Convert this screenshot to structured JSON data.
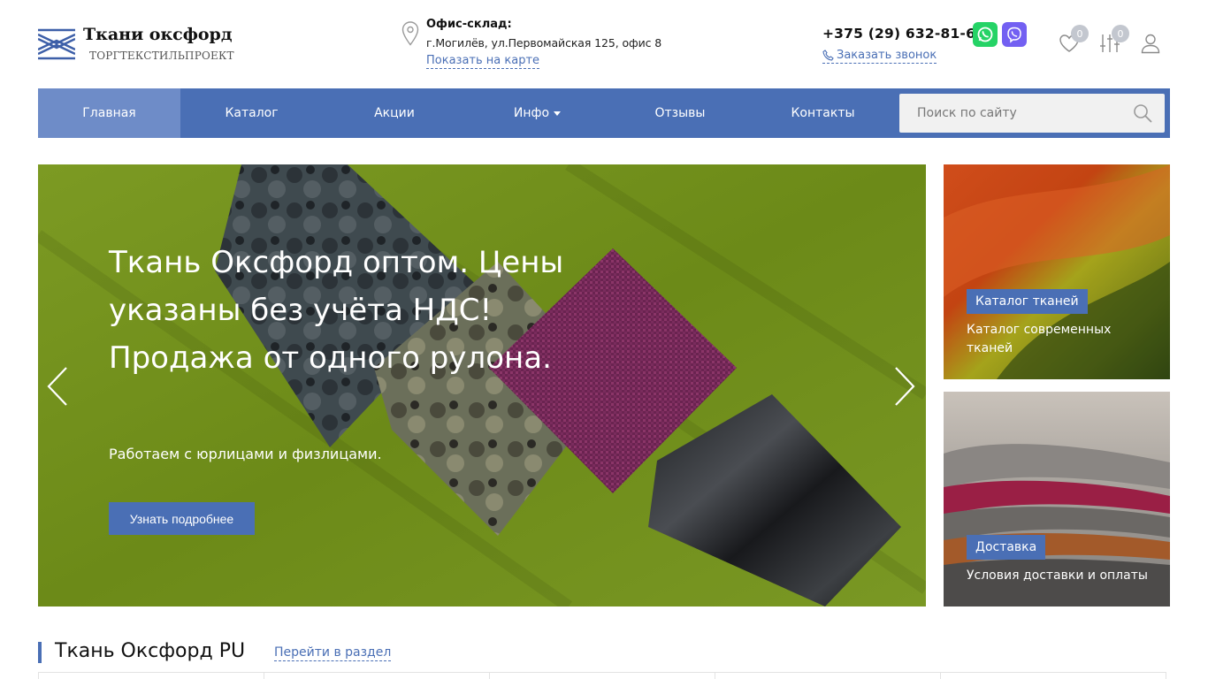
{
  "header": {
    "logo_title": "Ткани оксфорд",
    "logo_subtitle": "ТОРГТЕКСТИЛЬПРОЕКТ",
    "office_label": "Офис-склад:",
    "office_address": "г.Могилёв, ул.Первомайская 125, офис 8",
    "map_link": "Показать на карте",
    "phone": "+375 (29) 632-81-61",
    "call_link": "Заказать звонок",
    "favorites_count": "0",
    "compare_count": "0",
    "icons": {
      "pin": "map-pin-icon",
      "whatsapp": "whatsapp-icon",
      "viber": "viber-icon",
      "favorites": "heart-icon",
      "compare": "sliders-icon",
      "user": "user-icon",
      "call": "phone-icon"
    }
  },
  "nav": {
    "items": [
      {
        "label": "Главная",
        "active": true
      },
      {
        "label": "Каталог"
      },
      {
        "label": "Акции"
      },
      {
        "label": "Инфо"
      },
      {
        "label": "Отзывы"
      },
      {
        "label": "Контакты"
      }
    ],
    "search_placeholder": "Поиск по сайту"
  },
  "hero": {
    "title": "Ткань Оксфорд оптом. Цены указаны без учёта НДС! Продажа от одного рулона.",
    "subtitle": "Работаем с юрлицами и физлицами.",
    "button": "Узнать подробнее"
  },
  "cards": [
    {
      "tag": "Каталог тканей",
      "text": "Каталог современных тканей"
    },
    {
      "tag": "Доставка",
      "text": "Условия доставки и оплаты"
    }
  ],
  "section": {
    "title": "Ткань Оксфорд PU",
    "link": "Перейти в раздел"
  },
  "colors": {
    "accent": "#4a6fb5",
    "nav_active": "#6e8cc8",
    "hero_bg": "#6f8f1c"
  }
}
